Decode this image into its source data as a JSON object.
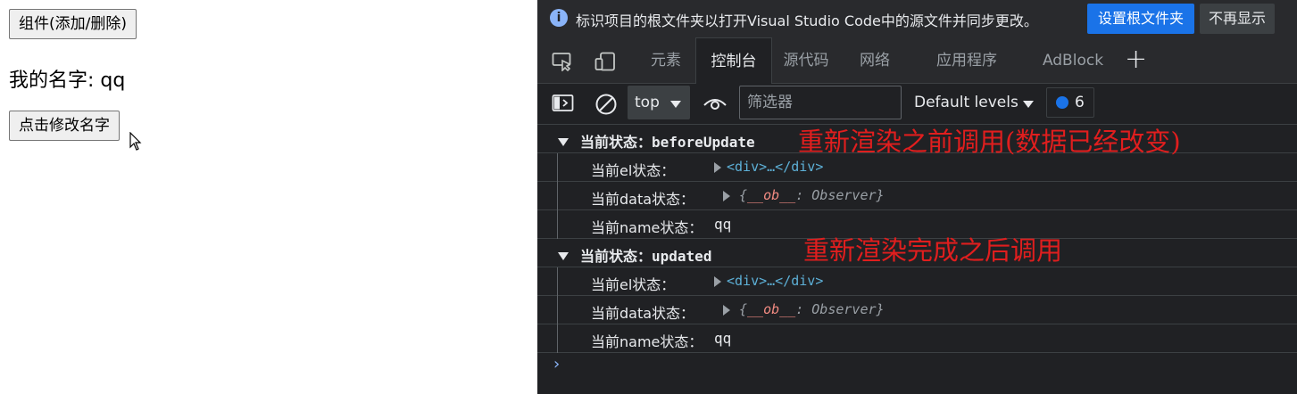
{
  "page": {
    "toggle_button": "组件(添加/删除)",
    "name_line": "我的名字: qq",
    "rename_button": "点击修改名字"
  },
  "devtools": {
    "infobar": {
      "message": "标识项目的根文件夹以打开Visual Studio Code中的源文件并同步更改。",
      "set_root_button": "设置根文件夹",
      "dismiss_button": "不再显示"
    },
    "tabs": [
      {
        "label": "元素",
        "active": false
      },
      {
        "label": "控制台",
        "active": true
      },
      {
        "label": "源代码",
        "active": false
      },
      {
        "label": "网络",
        "active": false
      },
      {
        "label": "应用程序",
        "active": false
      },
      {
        "label": "AdBlock",
        "active": false
      }
    ],
    "toolbar": {
      "context": "top",
      "filter_placeholder": "筛选器",
      "levels": "Default levels",
      "message_count": "6"
    },
    "console": {
      "groups": [
        {
          "title_prefix": "当前状态：",
          "title_value": "beforeUpdate",
          "annotation": "重新渲染之前调用(数据已经改变)",
          "rows": {
            "el_label": "当前el状态：",
            "el_value": "<div>…</div>",
            "data_label": "当前data状态：",
            "data_open": "{",
            "data_key": "__ob__",
            "data_value": ": Observer}",
            "name_label": "当前name状态：",
            "name_value": "qq"
          }
        },
        {
          "title_prefix": "当前状态：",
          "title_value": "updated",
          "annotation": "重新渲染完成之后调用",
          "rows": {
            "el_label": "当前el状态：",
            "el_value": "<div>…</div>",
            "data_label": "当前data状态：",
            "data_open": "{",
            "data_key": "__ob__",
            "data_value": ": Observer}",
            "name_label": "当前name状态：",
            "name_value": "qq"
          }
        }
      ],
      "prompt": "›"
    },
    "colors": {
      "panel_bg": "#202124",
      "toolbar_bg": "#292a2d",
      "primary_button": "#1a73e8",
      "annotation_red": "#e01e1e",
      "element_blue": "#5db0d7"
    }
  }
}
